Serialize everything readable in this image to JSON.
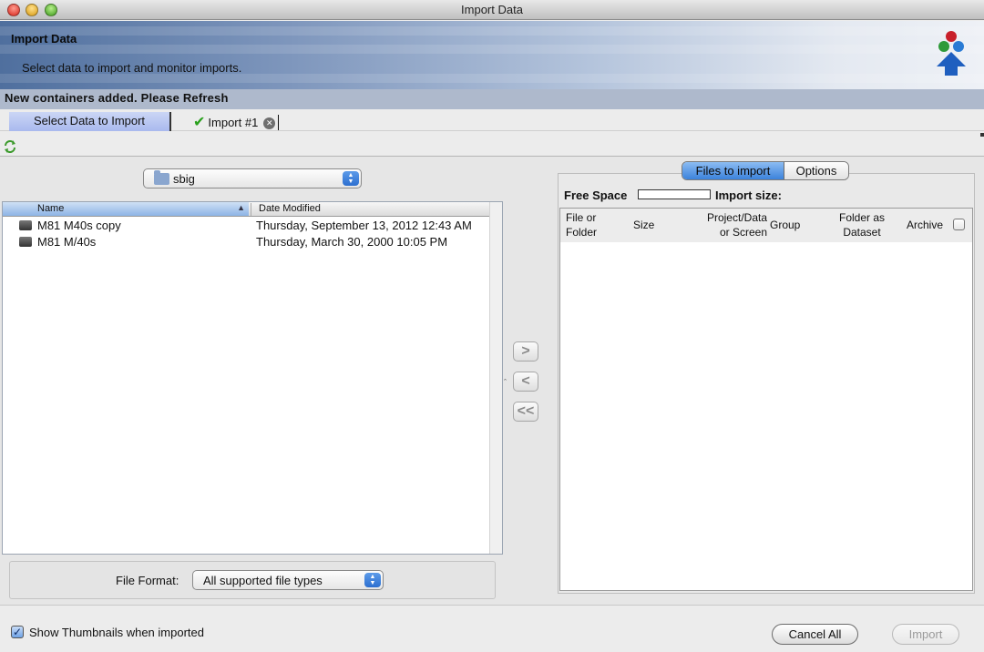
{
  "window": {
    "title": "Import Data"
  },
  "banner": {
    "heading": "Import Data",
    "subtitle": "Select data to import and monitor imports.",
    "logo_colors": [
      "#c8202a",
      "#2f9a3a",
      "#2a7bd4"
    ],
    "logo_arrow_color": "#1f5fbf"
  },
  "notice": "New containers added. Please Refresh",
  "tabs": [
    {
      "label": "Select Data to Import",
      "active": true
    },
    {
      "label": "Import #1",
      "status_icon": "checkmark-icon",
      "closable": true
    }
  ],
  "browser": {
    "directory": "sbig",
    "columns": [
      "Name",
      "Date Modified"
    ],
    "files": [
      {
        "name": "M81 M40s copy",
        "modified": "Thursday, September 13, 2012 12:43 AM"
      },
      {
        "name": "M81 M/40s",
        "modified": "Thursday, March 30, 2000 10:05 PM"
      }
    ],
    "file_format_label": "File Format:",
    "file_format_value": "All supported file types"
  },
  "transfer_buttons": {
    "add": ">",
    "remove": "<",
    "remove_all": "<<"
  },
  "import_panel": {
    "segments": [
      "Files to import",
      "Options"
    ],
    "free_space_label": "Free Space",
    "import_size_label": "Import size:",
    "columns": {
      "file_or_folder": [
        "File or",
        "Folder"
      ],
      "size": "Size",
      "project": [
        "Project/Data",
        "or Screen"
      ],
      "group": "Group",
      "folder_as_dataset": [
        "Folder as",
        "Dataset"
      ],
      "archive": "Archive"
    }
  },
  "footer": {
    "show_thumbnails_label": "Show Thumbnails when imported",
    "show_thumbnails_checked": true,
    "cancel_all": "Cancel All",
    "import": "Import"
  },
  "colors": {
    "selected_tab": "#b3c2f0",
    "segment_active": "#5a9be6",
    "notice_bar": "#aeb9cc"
  }
}
